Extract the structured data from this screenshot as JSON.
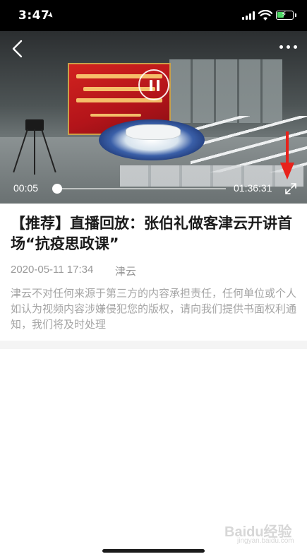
{
  "status_bar": {
    "time": "3:47",
    "icons": [
      "location-arrow-icon",
      "cellular-signal-icon",
      "wifi-icon",
      "battery-charging-icon"
    ],
    "battery_color": "#4cd964"
  },
  "video": {
    "current_time": "00:05",
    "total_time": "01:36:31",
    "progress_fraction": 0.0,
    "state": "paused",
    "icons": [
      "back-chevron-icon",
      "more-dots-icon",
      "pause-icon",
      "fullscreen-icon"
    ],
    "annotation_color": "#e8221b"
  },
  "article": {
    "title": "【推荐】直播回放：张伯礼做客津云开讲首场“抗疫思政课”",
    "date": "2020-05-11 17:34",
    "source": "津云",
    "disclaimer": "津云不对任何来源于第三方的内容承担责任，任何单位或个人如认为视频内容涉嫌侵犯您的版权，请向我们提供书面权利通知，我们将及时处理"
  },
  "watermark": {
    "brand": "Baidu经验",
    "sub": "jingyan.baidu.com"
  }
}
